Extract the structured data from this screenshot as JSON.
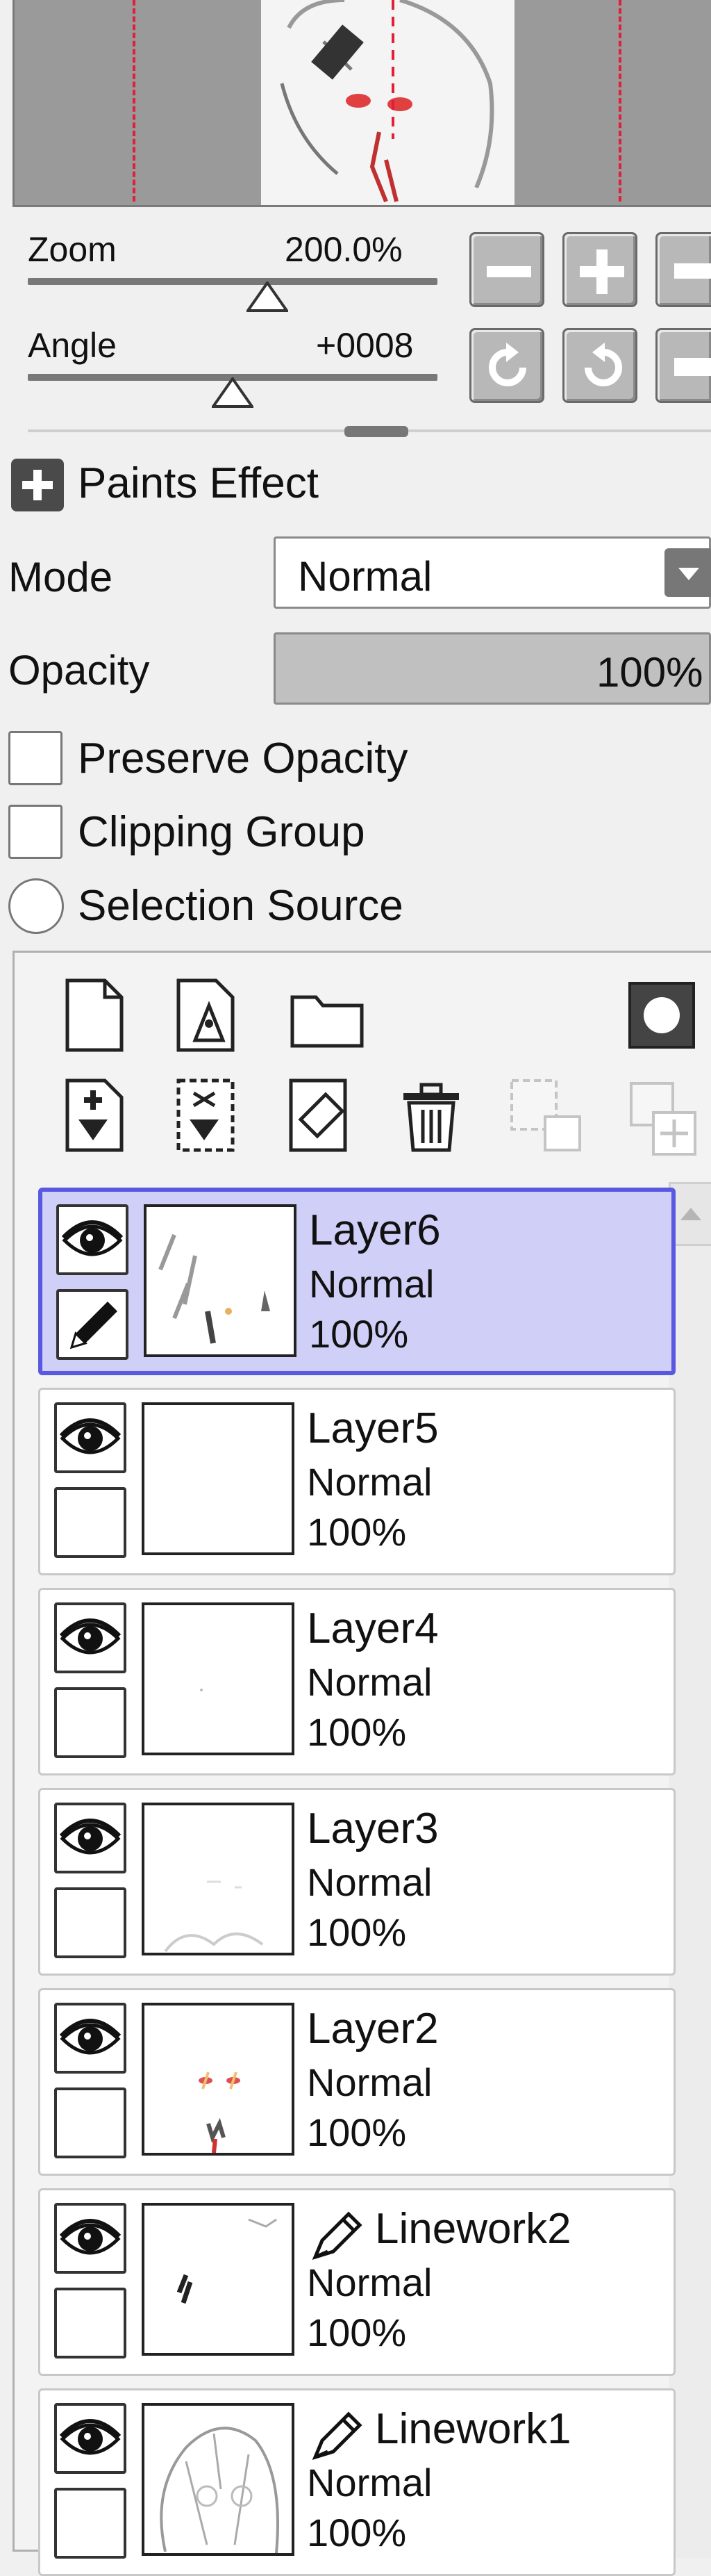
{
  "navigator": {
    "zoom_label": "Zoom",
    "zoom_value": "200.0%",
    "angle_label": "Angle",
    "angle_value": "+0008"
  },
  "paints_effect": {
    "title": "Paints Effect",
    "mode_label": "Mode",
    "mode_value": "Normal",
    "opacity_label": "Opacity",
    "opacity_value": "100%",
    "opacity_level": 1.0,
    "preserve_opacity": "Preserve Opacity",
    "clipping_group": "Clipping Group",
    "selection_source": "Selection Source"
  },
  "colors": {
    "selected_bg": "#cfcff8",
    "selected_border": "#5858e0",
    "guide_line": "#e0203a"
  },
  "layers": [
    {
      "name": "Layer6",
      "mode": "Normal",
      "opacity": "100%",
      "selected": true,
      "linework": false
    },
    {
      "name": "Layer5",
      "mode": "Normal",
      "opacity": "100%",
      "selected": false,
      "linework": false
    },
    {
      "name": "Layer4",
      "mode": "Normal",
      "opacity": "100%",
      "selected": false,
      "linework": false
    },
    {
      "name": "Layer3",
      "mode": "Normal",
      "opacity": "100%",
      "selected": false,
      "linework": false
    },
    {
      "name": "Layer2",
      "mode": "Normal",
      "opacity": "100%",
      "selected": false,
      "linework": false
    },
    {
      "name": "Linework2",
      "mode": "Normal",
      "opacity": "100%",
      "selected": false,
      "linework": true
    },
    {
      "name": "Linework1",
      "mode": "Normal",
      "opacity": "100%",
      "selected": false,
      "linework": true
    }
  ]
}
